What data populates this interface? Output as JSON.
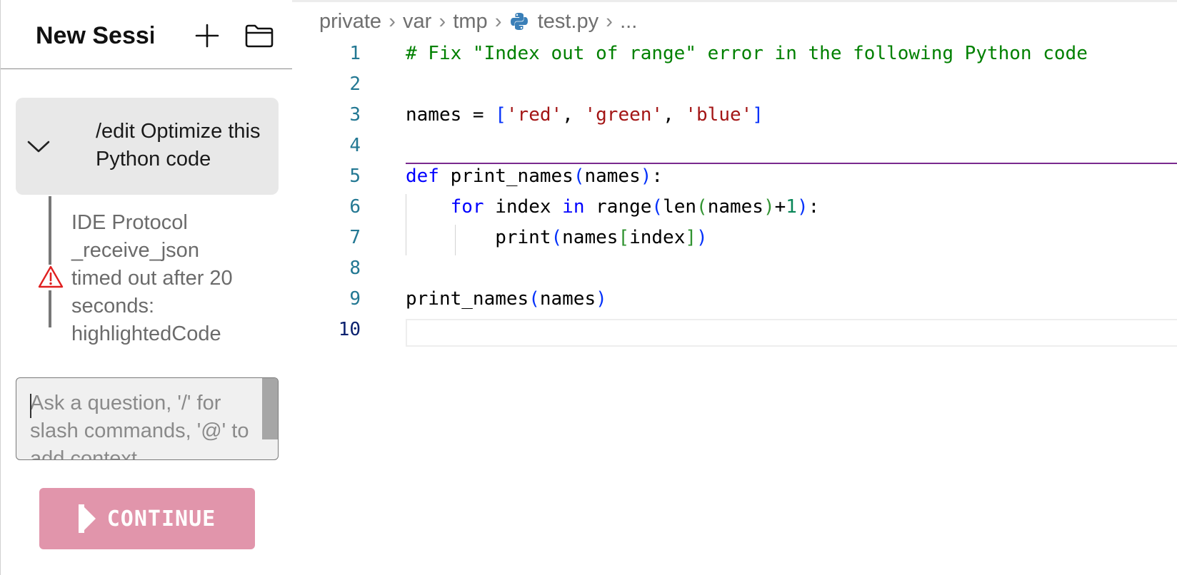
{
  "sidebar": {
    "session_title": "New Session",
    "new_session_icon": "plus-icon",
    "folder_icon": "folder-icon",
    "history_item": {
      "line1": "/edit Optimize this",
      "line2": "Python code",
      "expand_icon": "chevron-down-icon"
    },
    "error": {
      "icon": "warning-icon",
      "lines": [
        "IDE Protocol",
        "_receive_json",
        "timed out after 20",
        "seconds:",
        "highlightedCode"
      ]
    },
    "input": {
      "placeholder": "Ask a question, '/' for slash commands, '@' to add context"
    },
    "continue_button": {
      "label": "CONTINUE",
      "icon": "play-icon",
      "color": "#e195ab"
    }
  },
  "editor": {
    "breadcrumb": {
      "segments": [
        "private",
        "var",
        "tmp"
      ],
      "file": "test.py",
      "file_icon": "python-icon",
      "tail": "..."
    },
    "active_line": 10,
    "lines": [
      {
        "num": "1",
        "code": "# Fix \"Index out of range\" error in the following Python code"
      },
      {
        "num": "2",
        "code": ""
      },
      {
        "num": "3",
        "code": "names = ['red', 'green', 'blue']"
      },
      {
        "num": "4",
        "code": ""
      },
      {
        "num": "5",
        "code": "def print_names(names):"
      },
      {
        "num": "6",
        "code": "    for index in range(len(names)+1):"
      },
      {
        "num": "7",
        "code": "        print(names[index])"
      },
      {
        "num": "8",
        "code": ""
      },
      {
        "num": "9",
        "code": "print_names(names)"
      },
      {
        "num": "10",
        "code": ""
      }
    ],
    "colors": {
      "comment": "#008000",
      "string": "#a31515",
      "keyword": "#0000ff",
      "bracket": "#0431fa",
      "number": "#098658",
      "line_number": "#237893"
    }
  }
}
